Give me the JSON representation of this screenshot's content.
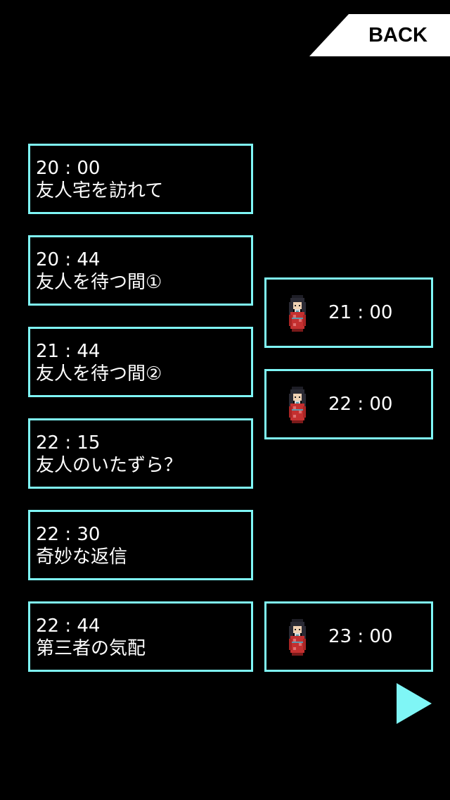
{
  "header": {
    "back_label": "BACK"
  },
  "chapters": [
    {
      "time": "20 : 00",
      "title": "友人宅を訪れて"
    },
    {
      "time": "20 : 44",
      "title": "友人を待つ間①"
    },
    {
      "time": "21 : 44",
      "title": "友人を待つ間②"
    },
    {
      "time": "22 : 15",
      "title": "友人のいたずら？"
    },
    {
      "time": "22 : 30",
      "title": "奇妙な返信"
    },
    {
      "time": "22 : 44",
      "title": "第三者の気配"
    }
  ],
  "side_chapters": [
    {
      "time": "21 : 00",
      "icon": "kimono-girl-icon"
    },
    {
      "time": "22 : 00",
      "icon": "kimono-girl-icon"
    },
    {
      "time": "23 : 00",
      "icon": "kimono-girl-icon"
    }
  ],
  "nav": {
    "next_icon": "next-page-arrow-icon"
  },
  "colors": {
    "background": "#000000",
    "accent": "#7ff6f6",
    "text": "#ffffff",
    "back_button": "#ffffff"
  }
}
